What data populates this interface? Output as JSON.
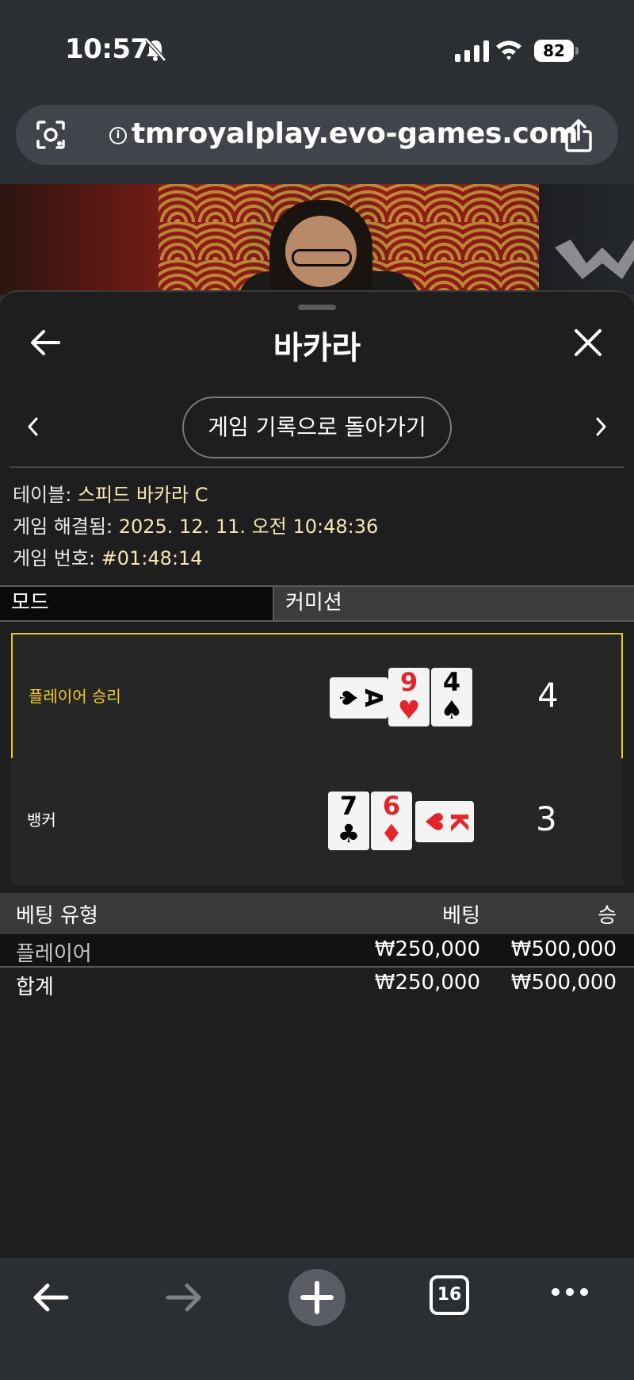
{
  "status_bar": {
    "time": "10:57",
    "battery": "82"
  },
  "browser": {
    "url": "tmroyalplay.evo-games.com",
    "info_glyph": "i",
    "tab_count": "16"
  },
  "sheet": {
    "title": "바카라",
    "history_button": "게임 기록으로 돌아가기",
    "info": [
      {
        "label": "테이블: ",
        "value": "스피드 바카라 C"
      },
      {
        "label": "게임 해결됨: ",
        "value": "2025. 12. 11. 오전 10:48:36"
      },
      {
        "label": "게임 번호: ",
        "value": "#01:48:14"
      }
    ],
    "mode_label": "모드",
    "commission_label": "커미션",
    "player": {
      "label": "플레이어 승리",
      "score": "4",
      "cards": [
        {
          "rank": "A",
          "suit": "♠",
          "color": "#000000"
        },
        {
          "rank": "9",
          "suit": "♥",
          "color": "#e3242b"
        },
        {
          "rank": "4",
          "suit": "♠",
          "color": "#000000"
        }
      ]
    },
    "banker": {
      "label": "뱅커",
      "score": "3",
      "cards": [
        {
          "rank": "7",
          "suit": "♣",
          "color": "#000000"
        },
        {
          "rank": "6",
          "suit": "♦",
          "color": "#e3242b"
        },
        {
          "rank": "K",
          "suit": "♥",
          "color": "#e3242b"
        }
      ]
    },
    "bets": {
      "headers": {
        "type": "베팅 유형",
        "bet": "베팅",
        "win": "승"
      },
      "rows": [
        {
          "type": "플레이어",
          "bet": "₩250,000",
          "win": "₩500,000"
        }
      ],
      "total": {
        "type": "합계",
        "bet": "₩250,000",
        "win": "₩500,000"
      }
    }
  },
  "colors": {
    "highlight": "#e6c619",
    "info_value": "#f5e7b6",
    "card_red": "#e3242b"
  }
}
